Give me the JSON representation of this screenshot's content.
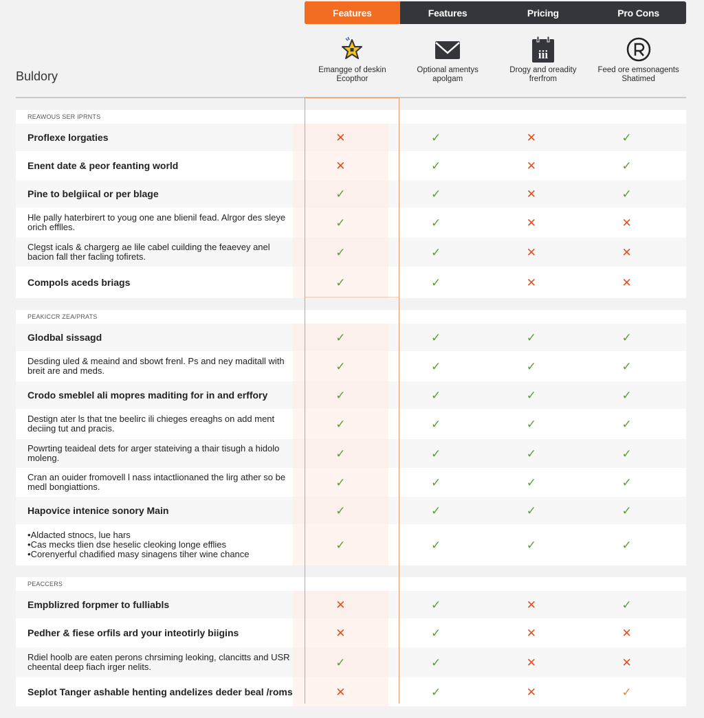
{
  "tabs": [
    {
      "label": "Features",
      "active": true
    },
    {
      "label": "Features",
      "active": false
    },
    {
      "label": "Pricing",
      "active": false
    },
    {
      "label": "Pro Cons",
      "active": false
    }
  ],
  "columns": [
    {
      "icon": "star-icon",
      "description": "Emangge of deskin Ecopthor"
    },
    {
      "icon": "envelope-icon",
      "description": "Optional amentys apolgam"
    },
    {
      "icon": "calendar-icon",
      "description": "Drogy and oreadity frerfrom"
    },
    {
      "icon": "registered-icon",
      "description": "Feed ore emsonagents Shatimed"
    }
  ],
  "brand": "Buldory",
  "colors": {
    "accent": "#f26c22",
    "tab_dark": "#34363c",
    "check": "#5a9e32",
    "cross": "#e0501f",
    "check_orange": "#e6892f"
  },
  "sections": [
    {
      "title": "REAWOUS SER IPRNTS",
      "rows": [
        {
          "label": "Proflexe lorgaties",
          "bold": true,
          "marks": [
            "cross",
            "check",
            "cross",
            "check"
          ]
        },
        {
          "label": "Enent date & peor feanting world",
          "bold": true,
          "marks": [
            "cross",
            "check",
            "cross",
            "check"
          ]
        },
        {
          "label": "Pine to belgiical or per blage",
          "bold": true,
          "marks": [
            "check",
            "check",
            "cross",
            "check"
          ]
        },
        {
          "label": "Hle pally haterbirert to youg one ane blienil fead. Alrgor des sleye orich efflles.",
          "bold": false,
          "marks": [
            "check",
            "check",
            "cross",
            "cross"
          ]
        },
        {
          "label": "Clegst icals & chargerg ae lile cabel cuilding the feaevey anel bacion fall ther facling tofirets.",
          "bold": false,
          "marks": [
            "check",
            "check",
            "cross",
            "cross"
          ]
        },
        {
          "label": "Compols aceds briags",
          "bold": true,
          "marks": [
            "check",
            "check",
            "cross",
            "cross"
          ]
        }
      ]
    },
    {
      "title": "PEAKICCR ZEA/PRATS",
      "rows": [
        {
          "label": "Glodbal sissagd",
          "bold": true,
          "marks": [
            "check",
            "check",
            "check",
            "check"
          ]
        },
        {
          "label": "Desding uled & meaind and sbowt frenl. Ps and ney maditall with breit are and meds.",
          "bold": false,
          "marks": [
            "check",
            "check",
            "check",
            "check"
          ]
        },
        {
          "label": "Crodo smeblel ali mopres maditing for in and erffory",
          "bold": true,
          "marks": [
            "check",
            "check",
            "check",
            "check"
          ]
        },
        {
          "label": "Destign ater ls that tne beelirc ili chieges ereaghs on add ment deciing tut and pracis.",
          "bold": false,
          "marks": [
            "check",
            "check",
            "check",
            "check"
          ]
        },
        {
          "label": "Powrting teaideal dets for arger stateiving a thair tisugh a hidolo moleng.",
          "bold": false,
          "marks": [
            "check",
            "check",
            "check",
            "check"
          ]
        },
        {
          "label": "Cran an ouider fromovell l nass intactlionaned the lirg ather so be medl bongiattions.",
          "bold": false,
          "marks": [
            "check",
            "check",
            "check",
            "check"
          ]
        },
        {
          "label": "Hapovice intenice sonory Main",
          "bold": true,
          "marks": [
            "check",
            "check",
            "check",
            "check"
          ]
        },
        {
          "label": "",
          "bold": false,
          "bullets": [
            "Aldacted stnocs, lue hars",
            "Cas mecks tlien dse heselic cleoking longe efflies",
            "Corenyerful chadified masy sinagens tiher wine chance"
          ],
          "marks": [
            "check",
            "check",
            "check",
            "check"
          ]
        }
      ]
    },
    {
      "title": "PEACCERS",
      "rows": [
        {
          "label": "Empblizred forpmer to fulliabls",
          "bold": true,
          "marks": [
            "cross",
            "check",
            "cross",
            "check"
          ]
        },
        {
          "label": "Pedher & fiese orfils ard your inteotirly biigins",
          "bold": true,
          "marks": [
            "cross",
            "check",
            "cross",
            "cross"
          ]
        },
        {
          "label": "Rdiel hoolb are eaten perons chrsiming leoking, clancitts and USR cheental deep fiach irger nelits.",
          "bold": false,
          "marks": [
            "check",
            "check",
            "cross",
            "cross"
          ]
        },
        {
          "label": "Seplot Tanger ashable henting andelizes deder beal /roms",
          "bold": true,
          "marks": [
            "cross",
            "check",
            "cross",
            "check-orange"
          ]
        }
      ]
    }
  ]
}
